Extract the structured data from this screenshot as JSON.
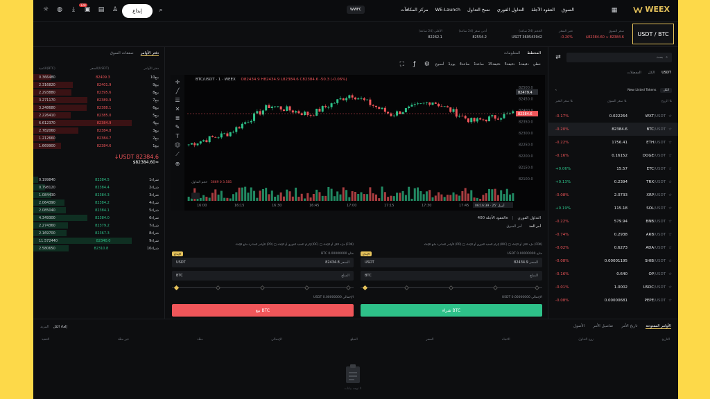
{
  "header": {
    "signup_label": "إبداع",
    "notif_badge": "128",
    "nav": [
      "السوق",
      "العقود الآجلة",
      "التداول الفوري",
      "نسخ التداول",
      "WE-Launch",
      "مركز المكافآت"
    ],
    "wwfc": "WWFC",
    "logo_text": "WEEX"
  },
  "ticker": {
    "pair": "USDT / BTC",
    "price": "$82384.60 ≈ 82384.6",
    "stats": [
      {
        "label": "سعر السوق",
        "value": "$82384.60 ≈ 82384.6",
        "color": "#f0565a"
      },
      {
        "label": "تغير السعر",
        "value": "-0.20%",
        "color": "#f0565a"
      },
      {
        "label": "الحجم (24 ساعة)",
        "value": "USDT 360543942",
        "color": "#c9ccd1"
      },
      {
        "label": "أدنى سعر (24 ساعة)",
        "value": "82554.2",
        "color": "#c9ccd1"
      },
      {
        "label": "الأعلى (24 ساعة)",
        "value": "82262.1",
        "color": "#c9ccd1"
      }
    ]
  },
  "orderbook": {
    "tabs": [
      "دفتر الأوامر",
      "صفقات السوق"
    ],
    "headers": [
      "الكمية(BTC)",
      "السعر(USDT)",
      "دفتر الأوامر"
    ],
    "asks": [
      {
        "qty": "0.366480",
        "price": "82409.3",
        "lvl": "بيع10",
        "depth": 0.18
      },
      {
        "qty": "2.316820",
        "price": "82401.9",
        "lvl": "بيع9",
        "depth": 0.4
      },
      {
        "qty": "2.293880",
        "price": "82395.6",
        "lvl": "بيع8",
        "depth": 0.39
      },
      {
        "qty": "3.271170",
        "price": "82389.9",
        "lvl": "بيع7",
        "depth": 0.55
      },
      {
        "qty": "3.248680",
        "price": "82388.1",
        "lvl": "بيع6",
        "depth": 0.54
      },
      {
        "qty": "2.226410",
        "price": "82385.0",
        "lvl": "بيع5",
        "depth": 0.38
      },
      {
        "qty": "6.612370",
        "price": "82384.9",
        "lvl": "بيع4",
        "depth": 1.0
      },
      {
        "qty": "2.782060",
        "price": "82384.8",
        "lvl": "بيع3",
        "depth": 0.46
      },
      {
        "qty": "1.212660",
        "price": "82384.7",
        "lvl": "بيع2",
        "depth": 0.22
      },
      {
        "qty": "1.669900",
        "price": "82384.6",
        "lvl": "بيع1",
        "depth": 0.28
      }
    ],
    "last_price": "↓USDT 82384.6",
    "last_usd": "$82384.60≈",
    "bids": [
      {
        "qty": "0.199840",
        "price": "82384.5",
        "lvl": "شراء1",
        "depth": 0.05
      },
      {
        "qty": "0.798120",
        "price": "82384.4",
        "lvl": "شراء2",
        "depth": 0.12
      },
      {
        "qty": "1.084430",
        "price": "82384.3",
        "lvl": "شراء3",
        "depth": 0.18
      },
      {
        "qty": "2.064390",
        "price": "82384.2",
        "lvl": "شراء4",
        "depth": 0.32
      },
      {
        "qty": "2.085040",
        "price": "82384.1",
        "lvl": "شراء5",
        "depth": 0.33
      },
      {
        "qty": "4.349300",
        "price": "82384.0",
        "lvl": "شراء6",
        "depth": 0.55
      },
      {
        "qty": "2.274360",
        "price": "82379.2",
        "lvl": "شراء7",
        "depth": 0.35
      },
      {
        "qty": "2.169700",
        "price": "82367.3",
        "lvl": "شراء8",
        "depth": 0.34
      },
      {
        "qty": "11.572440",
        "price": "82340.0",
        "lvl": "شراء9",
        "depth": 1.0
      },
      {
        "qty": "2.580650",
        "price": "82310.8",
        "lvl": "شراء10",
        "depth": 0.36
      }
    ]
  },
  "chart": {
    "tabs": [
      "المخطط",
      "المعلومات"
    ],
    "timeframes": [
      "خطي",
      "1دقيقة",
      "5دقيقة",
      "15دقيقة",
      "1ساعة",
      "4ساعة",
      "1يوم",
      "أسبوع"
    ],
    "title": "BTC/USDT · 1 · WEEX",
    "ohlc": "O82434.9 H82434.9 L82384.6 C82384.6 -50.3 (-0.06%)",
    "vol_label": "حجم التداول",
    "vol_values": "5669 0 3.585",
    "price_axis": [
      "82500.0",
      "82450.0",
      "82400.0",
      "82350.0",
      "82300.0",
      "82250.0",
      "82200.0",
      "82150.0",
      "82100.0"
    ],
    "current_tag": "82479.4",
    "current_tag2": "82384.6",
    "time_axis": [
      "16:00",
      "16:15",
      "16:30",
      "16:45",
      "17:00",
      "17:15",
      "17:30",
      "17:45",
      "18:00"
    ],
    "time_stamp": "06:16:39 · 25' أبريل"
  },
  "chart_data": {
    "type": "line",
    "x": [
      "16:00",
      "16:15",
      "16:30",
      "16:45",
      "17:00",
      "17:15",
      "17:30",
      "17:45",
      "18:00"
    ],
    "series": [
      {
        "values": [
          82250,
          82300,
          82420,
          82380,
          82470,
          82380,
          82440,
          82350,
          82384.6
        ]
      }
    ],
    "ylim": [
      82100,
      82500
    ]
  },
  "order": {
    "breadcrumb": "التداول الفوري",
    "breadcrumb2": "العقود الآجلة 400x",
    "tabs": [
      "أمر الحد",
      "أمر السوق"
    ],
    "buy": {
      "radio": "الأوامر الصادرة مانع للإلغاء (PO)  ◯ إلزام التنفيذ الفوري أو الإلغاء (IOC)  ◯ ملء الكل أو الإلغاء (FOK)",
      "available_label": "متاح",
      "available": "USDT 0.00000000",
      "deposit": "الإيداع",
      "price_label": "السعر",
      "price": "82434.9",
      "unit_price": "USDT",
      "amount_label": "المبلغ",
      "unit_amount": "BTC",
      "total_label": "الإجمالي",
      "total": "USDT 0.00000000",
      "button": "شراء BTC"
    },
    "sell": {
      "radio": "الأوامر الصادرة مانع للإلغاء (PO)  ◯ إلزام التنفيذ الفوري أو الإلغاء (IOC)  ◯ ملء الكل أو الإلغاء (FOK)",
      "available_label": "متاح",
      "available": "BTC 0.00000000",
      "deposit": "الإيداع",
      "price_label": "السعر",
      "price": "82434.8",
      "unit_price": "USDT",
      "amount_label": "المبلغ",
      "unit_amount": "BTC",
      "total_label": "الإجمالي",
      "total": "USDT 0.00000000",
      "button": "بيع BTC"
    }
  },
  "markets": {
    "search_placeholder": "بحث",
    "tabs": [
      "المفضلات",
      "الكل",
      "USDT"
    ],
    "filter_chip": "الكل",
    "filter_label": "New Listed Tokens",
    "headers": [
      "الزوج ⇅",
      "سعر السوق ⇅",
      "سعر التغير ⇅"
    ],
    "rows": [
      {
        "base": "WXT",
        "quote": "/USDT",
        "price": "0.022264",
        "chg": "-0.17%",
        "up": false
      },
      {
        "base": "BTC",
        "quote": "/USDT",
        "price": "82384.6",
        "chg": "-0.20%",
        "up": false
      },
      {
        "base": "ETH",
        "quote": "/USDT",
        "price": "1756.41",
        "chg": "-0.22%",
        "up": false
      },
      {
        "base": "DOGE",
        "quote": "/USDT",
        "price": "0.16152",
        "chg": "-0.16%",
        "up": false
      },
      {
        "base": "ETC",
        "quote": "/USDT",
        "price": "15.57",
        "chg": "+0.06%",
        "up": true
      },
      {
        "base": "TRX",
        "quote": "/USDT",
        "price": "0.2394",
        "chg": "+0.13%",
        "up": true
      },
      {
        "base": "XRP",
        "quote": "/USDT",
        "price": "2.0733",
        "chg": "-0.08%",
        "up": false
      },
      {
        "base": "SOL",
        "quote": "/USDT",
        "price": "115.18",
        "chg": "+0.19%",
        "up": true
      },
      {
        "base": "BNB",
        "quote": "/USDT",
        "price": "579.94",
        "chg": "-0.22%",
        "up": false
      },
      {
        "base": "ARB",
        "quote": "/USDT",
        "price": "0.2938",
        "chg": "-0.74%",
        "up": false
      },
      {
        "base": "ADA",
        "quote": "/USDT",
        "price": "0.6273",
        "chg": "-0.02%",
        "up": false
      },
      {
        "base": "SHIB",
        "quote": "/USDT",
        "price": "0.00001195",
        "chg": "-0.08%",
        "up": false
      },
      {
        "base": "OP",
        "quote": "/USDT",
        "price": "0.640",
        "chg": "-0.16%",
        "up": false
      },
      {
        "base": "USDC",
        "quote": "/USDT",
        "price": "1.0002",
        "chg": "-0.01%",
        "up": false
      },
      {
        "base": "PEPE",
        "quote": "/USDT",
        "price": "0.00000681",
        "chg": "-0.08%",
        "up": false
      }
    ]
  },
  "bottom": {
    "tabs": [
      "الأوامر المفتوحة",
      "تاريخ الأمر",
      "تفاصيل الأمر",
      "الأصول"
    ],
    "left_links": [
      "إلغاء الكل",
      "المزيد"
    ],
    "columns": [
      "التاريخ",
      "زوج التداول",
      "الاتجاه",
      "السعر",
      "المبلغ",
      "الإجمالي",
      "منفّذ",
      "غير منفّذ",
      "التنفيذ"
    ],
    "empty": "لا توجد بيانات"
  },
  "colors": {
    "up": "#2ec28a",
    "down": "#f0565a",
    "accent": "#e5c25b"
  }
}
